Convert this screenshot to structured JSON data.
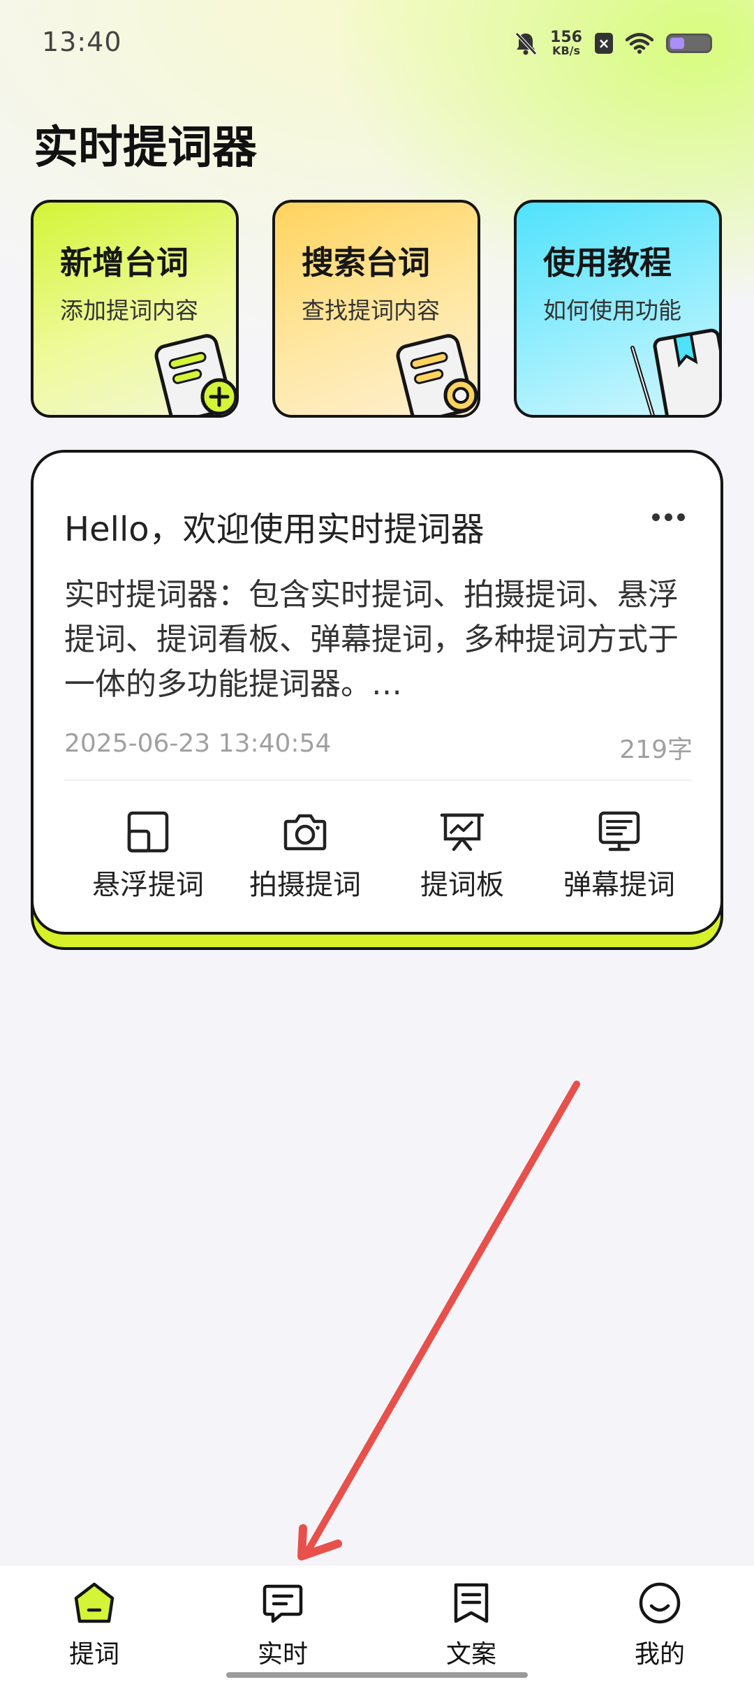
{
  "status_bar": {
    "time": "13:40",
    "net_speed_value": "156",
    "net_speed_unit": "KB/s",
    "icons": [
      "bell-off-icon",
      "sim-x-icon",
      "wifi-icon",
      "battery-icon"
    ]
  },
  "app_title": "实时提词器",
  "quick_actions": [
    {
      "title": "新增台词",
      "subtitle": "添加提词内容",
      "icon": "add-note-icon",
      "color": "#d3f437"
    },
    {
      "title": "搜索台词",
      "subtitle": "查找提词内容",
      "icon": "search-note-icon",
      "color": "#ffd35e"
    },
    {
      "title": "使用教程",
      "subtitle": "如何使用功能",
      "icon": "book-icon",
      "color": "#4fe2fb"
    }
  ],
  "script_card": {
    "title": "Hello，欢迎使用实时提词器",
    "body": "实时提词器：包含实时提词、拍摄提词、悬浮提词、提词看板、弹幕提词，多种提词方式于一体的多功能提词器。…",
    "datetime": "2025-06-23 13:40:54",
    "char_count": "219字",
    "modes": [
      {
        "label": "悬浮提词",
        "icon": "float-window-icon"
      },
      {
        "label": "拍摄提词",
        "icon": "camera-icon"
      },
      {
        "label": "提词板",
        "icon": "presentation-board-icon"
      },
      {
        "label": "弹幕提词",
        "icon": "danmaku-monitor-icon"
      }
    ]
  },
  "bottom_nav": [
    {
      "label": "提词",
      "icon": "home-icon",
      "active": true
    },
    {
      "label": "实时",
      "icon": "chat-bubble-icon",
      "active": false
    },
    {
      "label": "文案",
      "icon": "document-icon",
      "active": false
    },
    {
      "label": "我的",
      "icon": "smile-face-icon",
      "active": false
    }
  ],
  "colors": {
    "accent_lime": "#d6f029",
    "annotation_arrow": "#e8504b",
    "text_primary": "#111111",
    "text_muted": "#a0a0a0"
  }
}
